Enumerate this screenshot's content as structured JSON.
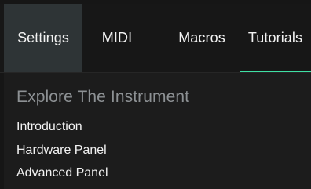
{
  "tabs": [
    {
      "label": "Settings",
      "active": false
    },
    {
      "label": "MIDI",
      "active": false
    },
    {
      "label": "Macros",
      "active": false
    },
    {
      "label": "Tutorials",
      "active": true
    }
  ],
  "section": {
    "title": "Explore The Instrument",
    "items": [
      "Introduction",
      "Hardware Panel",
      "Advanced Panel"
    ]
  },
  "colors": {
    "accent": "#3ee0a4",
    "active_tab_bg": "#2e3436",
    "title_text": "#8d9194",
    "text": "#f2f2f2"
  }
}
